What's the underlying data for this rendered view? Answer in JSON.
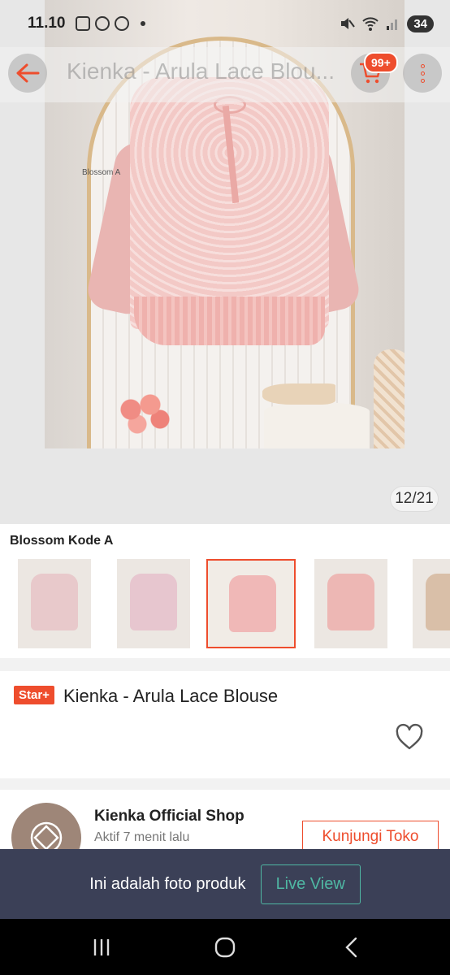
{
  "status_bar": {
    "time": "11.10",
    "battery": "34"
  },
  "header": {
    "title": "Kienka - Arula Lace Blou...",
    "cart_badge": "99+"
  },
  "gallery": {
    "photo_caption": "Blossom A",
    "counter": "12/21"
  },
  "variants": {
    "title": "Blossom Kode A",
    "items": [
      {
        "color": "#e8c9cb"
      },
      {
        "color": "#e7c6cf"
      },
      {
        "color": "#f0b8b7"
      },
      {
        "color": "#edb7b4"
      },
      {
        "color": "#d9bfa8"
      }
    ],
    "selected_index": 2
  },
  "product": {
    "badge": "Star+",
    "name": "Kienka - Arula Lace Blouse"
  },
  "shop": {
    "name": "Kienka Official Shop",
    "status": "Aktif 7 menit lalu",
    "visit_label": "Kunjungi Toko"
  },
  "banner": {
    "text": "Ini adalah foto produk",
    "button_label": "Live View"
  },
  "colors": {
    "accent": "#ee4d2d",
    "banner_bg": "#3b4057",
    "live_view": "#4fb7a3"
  }
}
